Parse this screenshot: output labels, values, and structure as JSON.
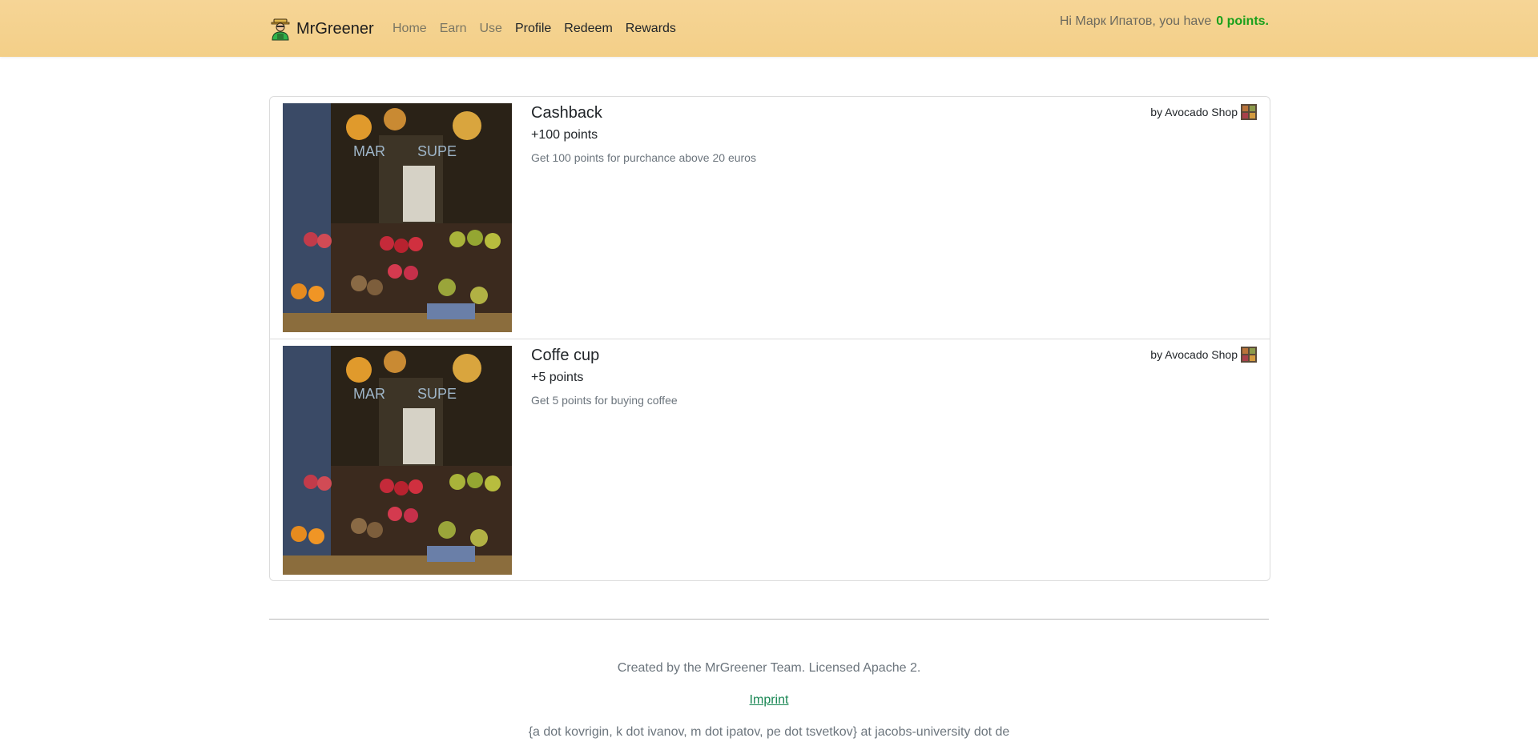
{
  "nav": {
    "brand": "MrGreener",
    "links": [
      {
        "label": "Home",
        "muted": true
      },
      {
        "label": "Earn",
        "muted": true
      },
      {
        "label": "Use",
        "muted": true
      },
      {
        "label": "Profile",
        "muted": false
      },
      {
        "label": "Redeem",
        "muted": false
      },
      {
        "label": "Rewards",
        "muted": false
      }
    ],
    "greeting": "Hi Марк Ипатов, you have",
    "points": "0 points."
  },
  "items": [
    {
      "title": "Cashback",
      "points": "+100 points",
      "description": "Get 100 points for purchance above 20 euros",
      "by": "by Avocado Shop"
    },
    {
      "title": "Coffe cup",
      "points": "+5 points",
      "description": "Get 5 points for buying coffee",
      "by": "by Avocado Shop"
    }
  ],
  "footer": {
    "credits": "Created by the MrGreener Team. Licensed Apache 2.",
    "imprint": "Imprint",
    "contacts": "{a dot kovrigin, k dot ivanov, m dot ipatov, pe dot tsvetkov} at jacobs-university dot de"
  },
  "colors": {
    "navbar": "#f5d391",
    "points_accent": "#19a01b",
    "link_green": "#198754"
  }
}
